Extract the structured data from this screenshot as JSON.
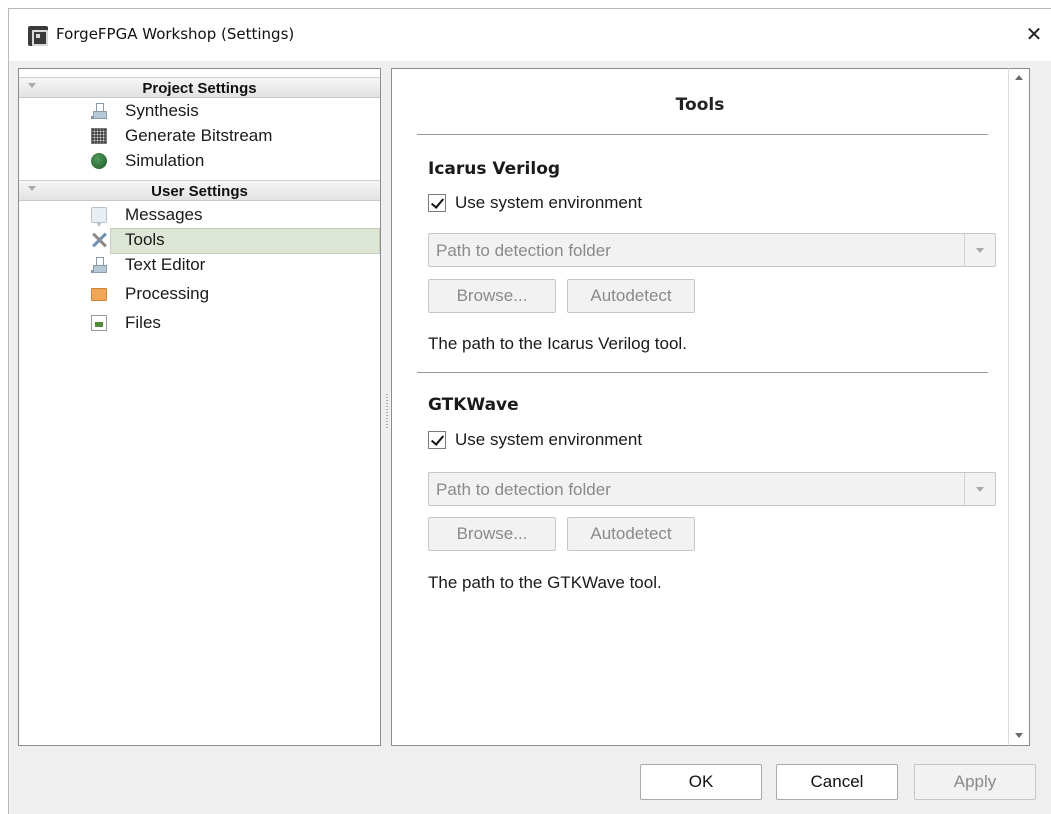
{
  "window": {
    "title": "ForgeFPGA Workshop (Settings)",
    "close_glyph": "✕"
  },
  "tree": {
    "groups": [
      {
        "header": "Project Settings",
        "items": [
          {
            "label": "Synthesis",
            "icon": "flask-icon"
          },
          {
            "label": "Generate Bitstream",
            "icon": "grid-icon"
          },
          {
            "label": "Simulation",
            "icon": "globe-icon"
          }
        ]
      },
      {
        "header": "User Settings",
        "items": [
          {
            "label": "Messages",
            "icon": "speech-bubble-icon"
          },
          {
            "label": "Tools",
            "icon": "wrench-screwdriver-icon",
            "selected": true
          },
          {
            "label": "Text Editor",
            "icon": "flask-icon"
          },
          {
            "label": "Processing",
            "icon": "folder-icon"
          },
          {
            "label": "Files",
            "icon": "file-icon"
          }
        ]
      }
    ]
  },
  "panel": {
    "title": "Tools",
    "sections": [
      {
        "title": "Icarus Verilog",
        "checkbox_label": "Use system environment",
        "checked": true,
        "path_placeholder": "Path to detection folder",
        "browse_label": "Browse...",
        "autodetect_label": "Autodetect",
        "help": "The path to the Icarus Verilog tool."
      },
      {
        "title": "GTKWave",
        "checkbox_label": "Use system environment",
        "checked": true,
        "path_placeholder": "Path to detection folder",
        "browse_label": "Browse...",
        "autodetect_label": "Autodetect",
        "help": "The path to the GTKWave tool."
      }
    ]
  },
  "buttons": {
    "ok": "OK",
    "cancel": "Cancel",
    "apply": "Apply"
  }
}
